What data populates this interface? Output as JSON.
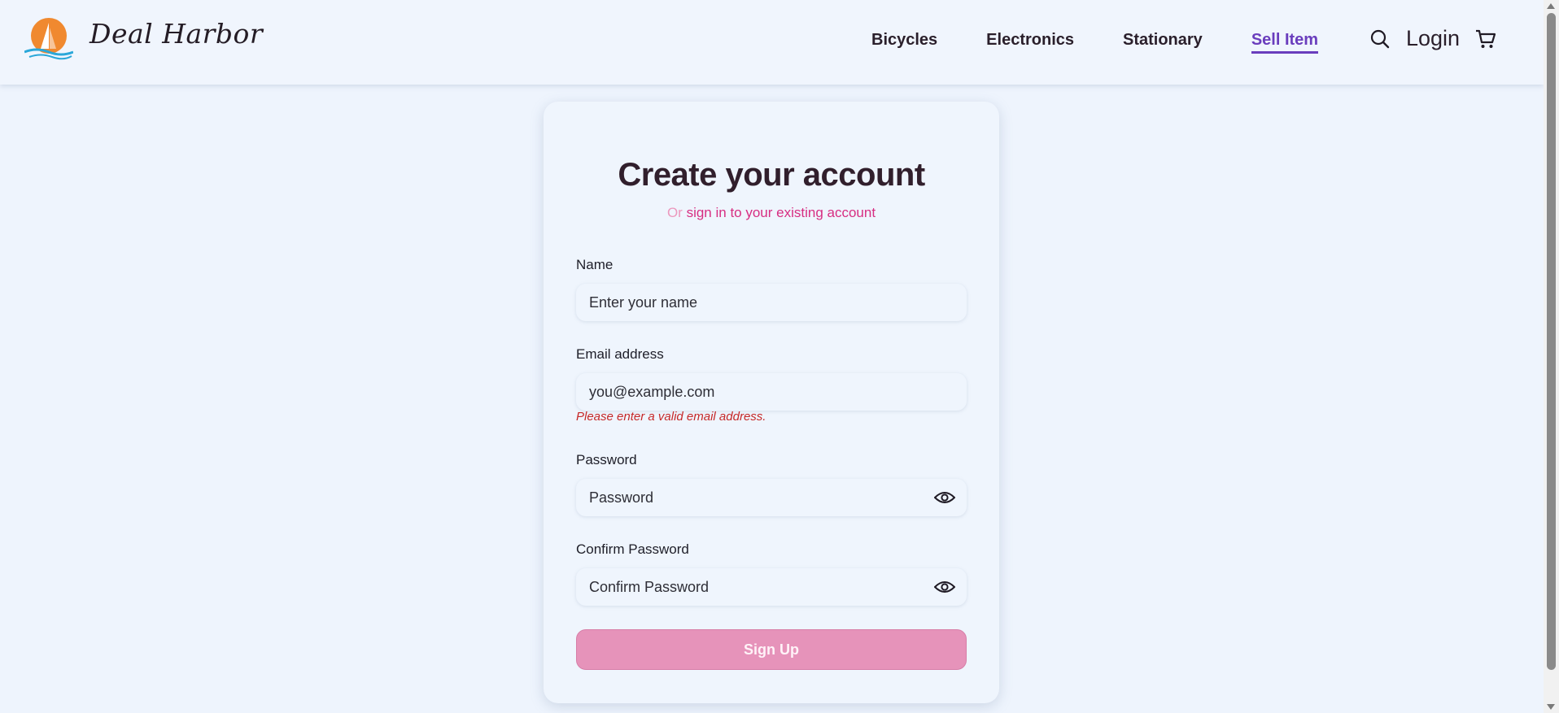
{
  "header": {
    "brand": "Deal Harbor",
    "nav": [
      {
        "label": "Bicycles"
      },
      {
        "label": "Electronics"
      },
      {
        "label": "Stationary"
      },
      {
        "label": "Sell Item",
        "active": true
      }
    ],
    "login_label": "Login",
    "icons": [
      "search-icon",
      "cart-icon"
    ]
  },
  "form": {
    "title": "Create your account",
    "subtitle_or": "Or",
    "subtitle_link": "sign in to your existing account",
    "name": {
      "label": "Name",
      "placeholder": "Enter your name",
      "value": ""
    },
    "email": {
      "label": "Email address",
      "placeholder": "you@example.com",
      "value": "",
      "error": "Please enter a valid email address."
    },
    "password": {
      "label": "Password",
      "placeholder": "Password",
      "value": ""
    },
    "confirm_password": {
      "label": "Confirm Password",
      "placeholder": "Confirm Password",
      "value": ""
    },
    "submit_label": "Sign Up"
  },
  "colors": {
    "accent_nav": "#6a3dbd",
    "link_pink": "#d72e82",
    "button_pink": "#e693ba",
    "error_red": "#c62828",
    "background": "#eef4fd"
  }
}
